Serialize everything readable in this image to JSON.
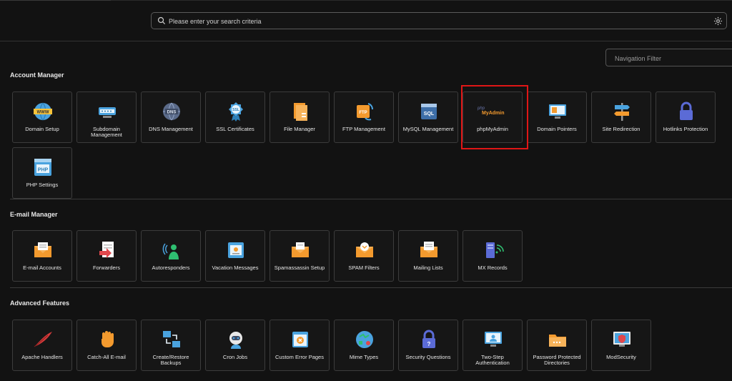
{
  "search": {
    "placeholder": "Please enter your search criteria",
    "icon": "search-icon",
    "settings_icon": "gear-icon"
  },
  "nav_filter": {
    "placeholder": "Navigation Filter"
  },
  "sections": {
    "account": {
      "title": "Account Manager",
      "items": [
        {
          "label": "Domain Setup",
          "icon": "www-globe-icon"
        },
        {
          "label": "Subdomain Management",
          "icon": "subdomain-icon"
        },
        {
          "label": "DNS Management",
          "icon": "dns-globe-icon"
        },
        {
          "label": "SSL Certificates",
          "icon": "ssl-badge-icon"
        },
        {
          "label": "File Manager",
          "icon": "file-manager-icon"
        },
        {
          "label": "FTP Management",
          "icon": "ftp-icon"
        },
        {
          "label": "MySQL Management",
          "icon": "mysql-icon"
        },
        {
          "label": "phpMyAdmin",
          "icon": "phpmyadmin-logo",
          "logo_top": "php",
          "logo_bottom": "MyAdmin"
        },
        {
          "label": "Domain Pointers",
          "icon": "domain-pointer-icon"
        },
        {
          "label": "Site Redirection",
          "icon": "signpost-icon"
        },
        {
          "label": "Hotlinks Protection",
          "icon": "lock-icon"
        },
        {
          "label": "PHP Settings",
          "icon": "php-settings-icon",
          "badge": "PHP"
        }
      ]
    },
    "email": {
      "title": "E-mail Manager",
      "items": [
        {
          "label": "E-mail Accounts",
          "icon": "email-envelope-icon"
        },
        {
          "label": "Forwarders",
          "icon": "forward-mail-icon"
        },
        {
          "label": "Autoresponders",
          "icon": "autoresponder-icon"
        },
        {
          "label": "Vacation Messages",
          "icon": "vacation-message-icon"
        },
        {
          "label": "Spamassassin Setup",
          "icon": "spamassassin-icon"
        },
        {
          "label": "SPAM Filters",
          "icon": "spam-filter-icon"
        },
        {
          "label": "Mailing Lists",
          "icon": "mailing-list-icon"
        },
        {
          "label": "MX Records",
          "icon": "mx-records-icon"
        }
      ]
    },
    "advanced": {
      "title": "Advanced Features",
      "items": [
        {
          "label": "Apache Handlers",
          "icon": "apache-feather-icon"
        },
        {
          "label": "Catch-All E-mail",
          "icon": "hand-icon"
        },
        {
          "label": "Create/Restore Backups",
          "icon": "backup-icon"
        },
        {
          "label": "Cron Jobs",
          "icon": "cron-robot-icon"
        },
        {
          "label": "Custom Error Pages",
          "icon": "error-page-icon"
        },
        {
          "label": "Mime Types",
          "icon": "mime-types-icon"
        },
        {
          "label": "Security Questions",
          "icon": "security-question-icon"
        },
        {
          "label": "Two-Step Authentication",
          "icon": "two-step-auth-icon"
        },
        {
          "label": "Password Protected Directories",
          "icon": "password-folder-icon"
        },
        {
          "label": "ModSecurity",
          "icon": "modsecurity-icon"
        }
      ]
    }
  },
  "colors": {
    "background": "#121212",
    "tile_border": "#3c3c3c",
    "highlight": "#e01616",
    "accent_orange": "#f39a2e",
    "accent_blue": "#4aa3df"
  }
}
